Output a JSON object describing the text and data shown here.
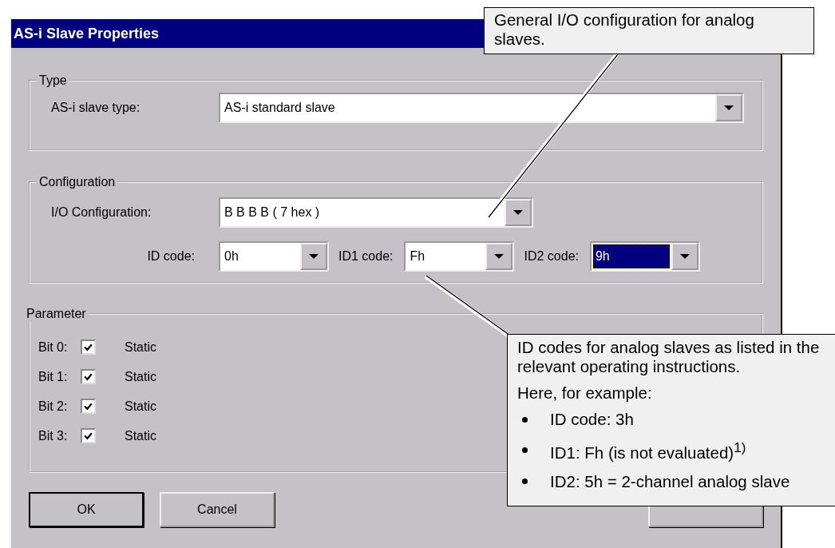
{
  "window": {
    "title": "AS-i Slave Properties"
  },
  "type_group": {
    "legend": "Type",
    "label": "AS-i slave type:",
    "value": "AS-i standard slave",
    "focused": false
  },
  "configuration_group": {
    "legend": "Configuration",
    "io": {
      "label": "I/O Configuration:",
      "value": "B  B  B  B ( 7 hex )",
      "focused": false
    },
    "codes": [
      {
        "label": "ID code:",
        "value": "0h",
        "focused": false
      },
      {
        "label": "ID1 code:",
        "value": "Fh",
        "focused": false
      },
      {
        "label": "ID2 code:",
        "value": "9h",
        "focused": true
      }
    ]
  },
  "parameter_group": {
    "legend": "Parameter",
    "bits": [
      {
        "label": "Bit 0:",
        "checked": true,
        "text": "Static"
      },
      {
        "label": "Bit 1:",
        "checked": true,
        "text": "Static"
      },
      {
        "label": "Bit 2:",
        "checked": true,
        "text": "Static"
      },
      {
        "label": "Bit 3:",
        "checked": true,
        "text": "Static"
      }
    ]
  },
  "buttons": [
    {
      "kind": "text",
      "label": "OK"
    },
    {
      "kind": "text",
      "label": "Cancel"
    },
    {
      "kind": "covered"
    }
  ],
  "callouts": [
    {
      "paragraphs": [
        "General I/O configuration for analog slaves."
      ]
    },
    {
      "paragraphs": [
        "ID codes for analog slaves as listed in the relevant operating instructions.",
        "Here, for example:"
      ],
      "bullets": [
        "ID code: 3h",
        "ID1: Fh (is not evaluated)$^{1)}$",
        "ID2: 5h = 2-channel analog slave"
      ]
    }
  ]
}
